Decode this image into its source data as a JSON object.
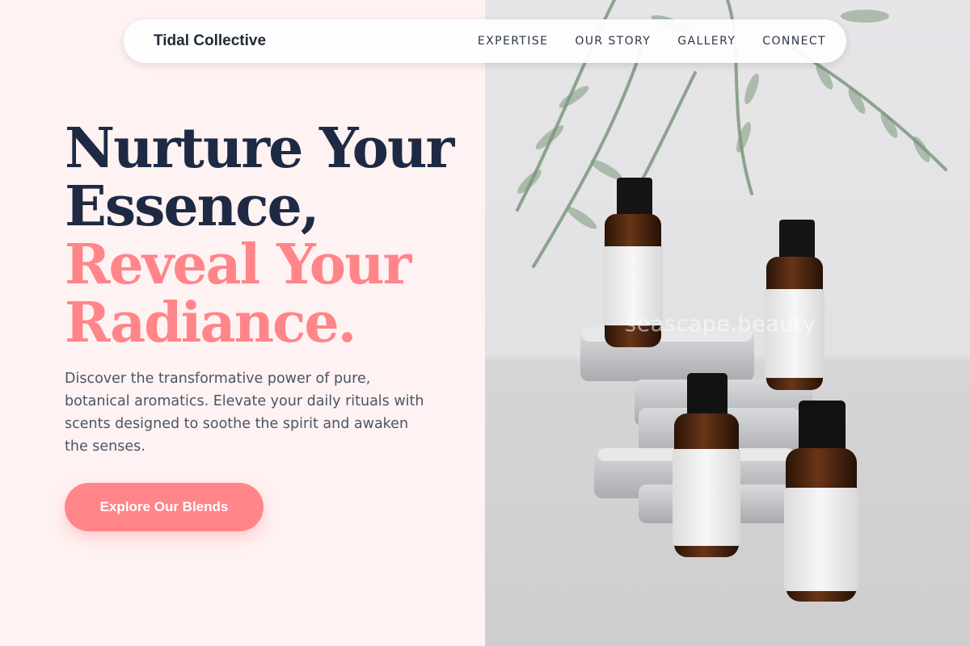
{
  "brand": {
    "name": "Tidal Collective"
  },
  "nav": {
    "links": [
      "EXPERTISE",
      "OUR STORY",
      "GALLERY",
      "CONNECT"
    ]
  },
  "hero": {
    "headline_dark": [
      "Nurture Your",
      "Essence,"
    ],
    "headline_accent": [
      "Reveal Your",
      "Radiance."
    ],
    "description": "Discover the transformative power of pure, botanical aromatics. Elevate your daily rituals with scents designed to soothe the spirit and awaken the senses.",
    "cta_label": "Explore Our Blends"
  },
  "photo": {
    "watermark": "seascape.beauty"
  },
  "colors": {
    "background": "#fff2f2",
    "heading": "#1e2a44",
    "accent": "#ff8589",
    "body_text": "#4a5568"
  }
}
